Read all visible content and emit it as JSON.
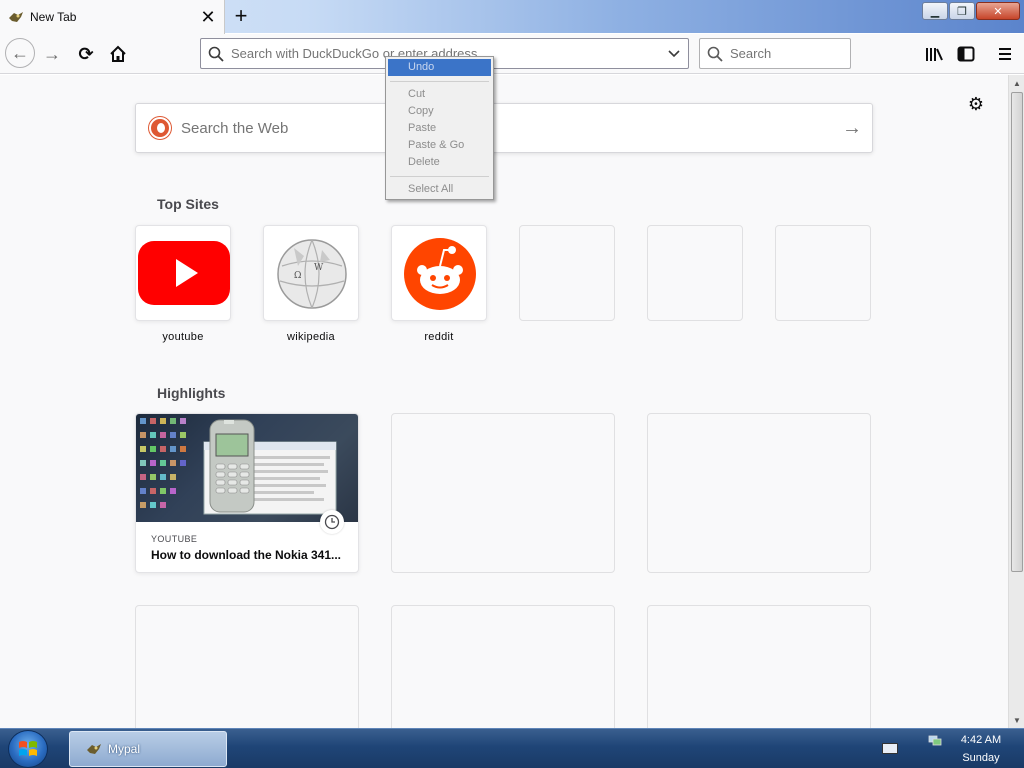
{
  "browser": {
    "tab": {
      "title": "New Tab",
      "close_glyph": "✕"
    },
    "newtab_glyph": "+",
    "window_controls": {
      "minimize": "▁",
      "restore": "❐",
      "close": "✕"
    },
    "nav": {
      "back_glyph": "←",
      "forward_glyph": "→",
      "reload_glyph": "⟳"
    },
    "urlbar": {
      "placeholder": "Search with DuckDuckGo or enter address",
      "value": ""
    },
    "searchbar": {
      "placeholder": "Search",
      "value": ""
    }
  },
  "newtab": {
    "settings_glyph": "⚙",
    "websearch": {
      "placeholder": "Search the Web",
      "go_glyph": "→"
    },
    "top_sites": {
      "title": "Top Sites",
      "sites": [
        {
          "label": "youtube",
          "color": "#ff0000"
        },
        {
          "label": "wikipedia",
          "color": "#dddddd"
        },
        {
          "label": "reddit",
          "color": "#ff4500"
        }
      ]
    },
    "highlights": {
      "title": "Highlights",
      "cards": [
        {
          "source": "YOUTUBE",
          "title": "How to download the Nokia 341..."
        }
      ]
    }
  },
  "context_menu": {
    "items": [
      "Undo",
      "Cut",
      "Copy",
      "Paste",
      "Paste & Go",
      "Delete",
      "Select All"
    ],
    "hovered": "Undo",
    "enabled": []
  },
  "taskbar": {
    "app_label": "Mypal",
    "time": "4:42 AM",
    "day": "Sunday"
  },
  "colors": {
    "accent": "#3b74c8",
    "youtube_red": "#ff0000",
    "reddit_orange": "#ff4500",
    "ddg_orange": "#de5833"
  }
}
